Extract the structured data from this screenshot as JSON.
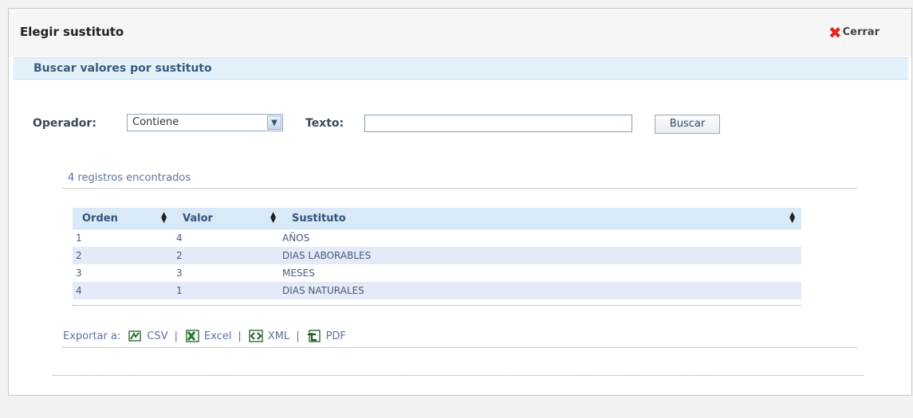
{
  "dialog": {
    "title": "Elegir sustituto",
    "close_label": "Cerrar"
  },
  "section": {
    "title": "Buscar valores por sustituto"
  },
  "search": {
    "operator_label": "Operador:",
    "operator_value": "Contiene",
    "text_label": "Texto:",
    "text_value": "",
    "button_label": "Buscar"
  },
  "results": {
    "count_text": "4 registros encontrados",
    "columns": [
      "Orden",
      "Valor",
      "Sustituto"
    ],
    "rows": [
      {
        "orden": "1",
        "valor": "4",
        "sustituto": "AÑOS"
      },
      {
        "orden": "2",
        "valor": "2",
        "sustituto": "DIAS LABORABLES"
      },
      {
        "orden": "3",
        "valor": "3",
        "sustituto": "MESES"
      },
      {
        "orden": "4",
        "valor": "1",
        "sustituto": "DIAS NATURALES"
      }
    ]
  },
  "export": {
    "label": "Exportar a:",
    "formats": [
      "CSV",
      "Excel",
      "XML",
      "PDF"
    ]
  },
  "colors": {
    "close_accent": "#e02a1c",
    "section_bg": "#e3f1fb",
    "header_bg": "#d9e9f7",
    "alt_row_bg": "#e4eaf8"
  }
}
